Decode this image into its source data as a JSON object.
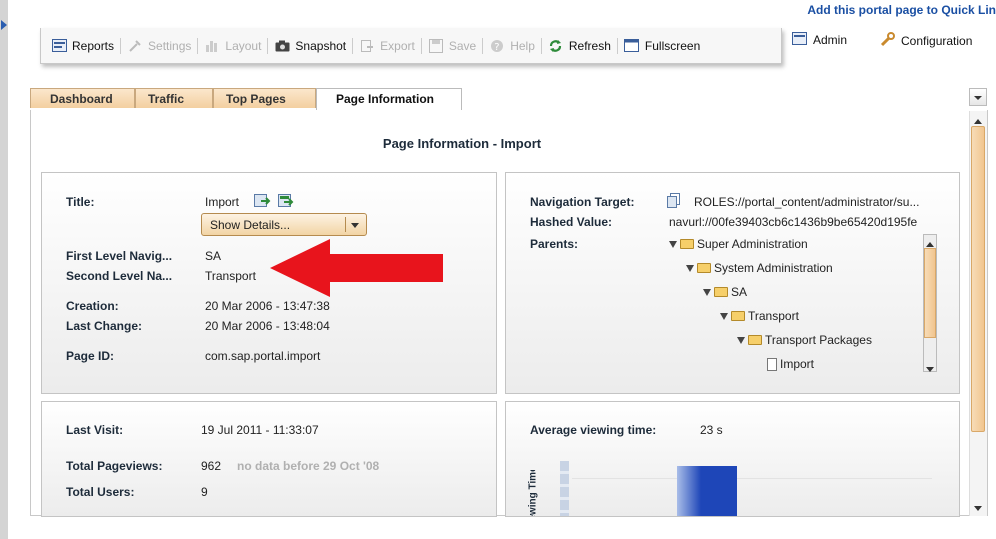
{
  "header": {
    "quick_link": "Add this portal page to Quick Lin"
  },
  "toolbar": {
    "reports": "Reports",
    "settings": "Settings",
    "layout": "Layout",
    "snapshot": "Snapshot",
    "export": "Export",
    "save": "Save",
    "help": "Help",
    "refresh": "Refresh",
    "fullscreen": "Fullscreen"
  },
  "admin_nav": {
    "admin": "Admin",
    "configuration": "Configuration"
  },
  "tabs": [
    "Dashboard",
    "Traffic",
    "Top Pages",
    "Page Information"
  ],
  "page": {
    "heading": "Page Information - Import",
    "title_label": "Title:",
    "title_value": "Import",
    "show_details": "Show Details...",
    "first_level_label": "First Level Navig...",
    "first_level_value": "SA",
    "second_level_label": "Second Level Na...",
    "second_level_value": "Transport",
    "creation_label": "Creation:",
    "creation_value": "20 Mar 2006 - 13:47:38",
    "last_change_label": "Last Change:",
    "last_change_value": "20 Mar 2006 - 13:48:04",
    "page_id_label": "Page ID:",
    "page_id_value": "com.sap.portal.import"
  },
  "nav": {
    "target_label": "Navigation Target:",
    "target_value": "ROLES://portal_content/administrator/su...",
    "hashed_label": "Hashed Value:",
    "hashed_value": "navurl://00fe39403cb6c1436b9be65420d195fe",
    "parents_label": "Parents:",
    "tree": [
      "Super Administration",
      "System Administration",
      "SA",
      "Transport",
      "Transport Packages",
      "Import"
    ]
  },
  "stats": {
    "last_visit_label": "Last Visit:",
    "last_visit_value": "19 Jul 2011 - 11:33:07",
    "pageviews_label": "Total Pageviews:",
    "pageviews_value": "962",
    "pageviews_note": "no data before 29 Oct '08",
    "users_label": "Total Users:",
    "users_value": "9"
  },
  "viewing": {
    "avg_label": "Average viewing time:",
    "avg_value": "23 s",
    "axis_label": "ewing Time"
  },
  "colors": {
    "accent_tab": "#f3cfa0",
    "link": "#1a4fa3",
    "bar": "#1e46b8",
    "arrow": "#e8141c"
  }
}
